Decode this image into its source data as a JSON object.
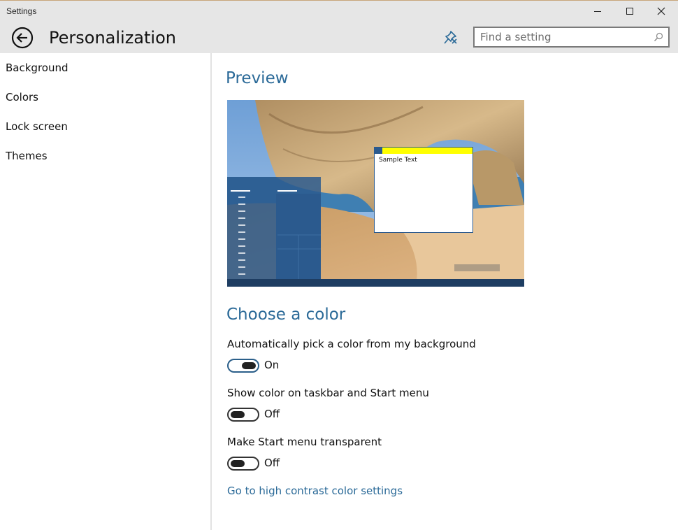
{
  "window": {
    "title": "Settings"
  },
  "header": {
    "page_title": "Personalization",
    "search_placeholder": "Find a setting"
  },
  "sidebar": {
    "items": [
      {
        "label": "Background"
      },
      {
        "label": "Colors"
      },
      {
        "label": "Lock screen"
      },
      {
        "label": "Themes"
      }
    ]
  },
  "main": {
    "preview_title": "Preview",
    "preview_sample_text": "Sample Text",
    "choose_color_title": "Choose a color",
    "settings": [
      {
        "label": "Automatically pick a color from my background",
        "state": "On"
      },
      {
        "label": "Show color on taskbar and Start menu",
        "state": "Off"
      },
      {
        "label": "Make Start menu transparent",
        "state": "Off"
      }
    ],
    "high_contrast_link": "Go to high contrast color settings"
  },
  "colors": {
    "accent": "#2b6a98",
    "start_menu": "#2b5a8e",
    "titlebar_sample": "#ffff00",
    "taskbar": "#1e3d62"
  },
  "icons": {
    "back": "back-arrow-icon",
    "pin": "pin-icon",
    "search": "search-icon",
    "minimize": "minimize-icon",
    "maximize": "maximize-icon",
    "close": "close-icon"
  }
}
